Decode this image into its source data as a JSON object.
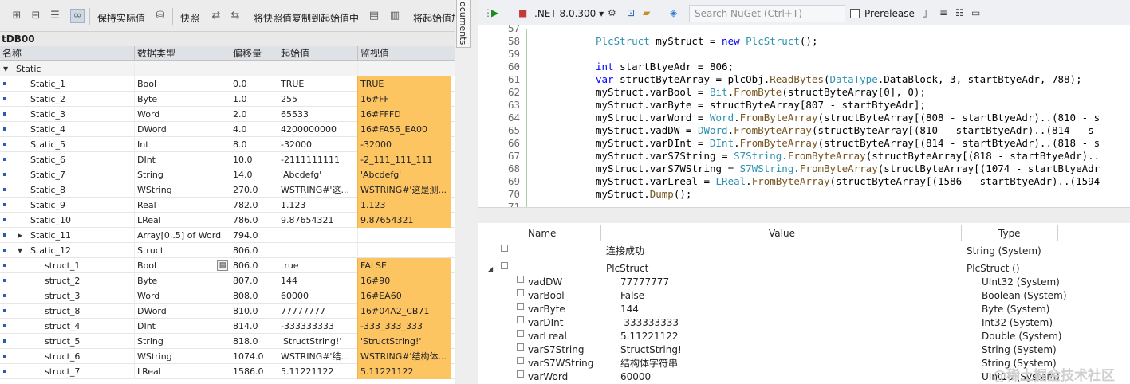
{
  "left": {
    "toolbar": {
      "keep_actual": "保持实际值",
      "snapshot": "快照",
      "copy_snapshot": "将快照值复制到起始值中",
      "start_to": "将起始值加"
    },
    "db_title": "tDB00",
    "headers": [
      "名称",
      "数据类型",
      "偏移量",
      "起始值",
      "监视值"
    ],
    "rows": [
      {
        "name": "Static",
        "type": "",
        "offset": "",
        "start": "",
        "monitor": "",
        "level": 0,
        "expand": "▼",
        "marker": false
      },
      {
        "name": "Static_1",
        "type": "Bool",
        "offset": "0.0",
        "start": "TRUE",
        "monitor": "TRUE",
        "level": 1,
        "marker": true
      },
      {
        "name": "Static_2",
        "type": "Byte",
        "offset": "1.0",
        "start": "255",
        "monitor": "16#FF",
        "level": 1,
        "marker": true
      },
      {
        "name": "Static_3",
        "type": "Word",
        "offset": "2.0",
        "start": "65533",
        "monitor": "16#FFFD",
        "level": 1,
        "marker": true
      },
      {
        "name": "Static_4",
        "type": "DWord",
        "offset": "4.0",
        "start": "4200000000",
        "monitor": "16#FA56_EA00",
        "level": 1,
        "marker": true
      },
      {
        "name": "Static_5",
        "type": "Int",
        "offset": "8.0",
        "start": "-32000",
        "monitor": "-32000",
        "level": 1,
        "marker": true
      },
      {
        "name": "Static_6",
        "type": "DInt",
        "offset": "10.0",
        "start": "-2111111111",
        "monitor": "-2_111_111_111",
        "level": 1,
        "marker": true
      },
      {
        "name": "Static_7",
        "type": "String",
        "offset": "14.0",
        "start": "'Abcdefg'",
        "monitor": "'Abcdefg'",
        "level": 1,
        "marker": true
      },
      {
        "name": "Static_8",
        "type": "WString",
        "offset": "270.0",
        "start": "WSTRING#'这...",
        "monitor": "WSTRING#'这是测...",
        "level": 1,
        "marker": true
      },
      {
        "name": "Static_9",
        "type": "Real",
        "offset": "782.0",
        "start": "1.123",
        "monitor": "1.123",
        "level": 1,
        "marker": true
      },
      {
        "name": "Static_10",
        "type": "LReal",
        "offset": "786.0",
        "start": "9.87654321",
        "monitor": "9.87654321",
        "level": 1,
        "marker": true
      },
      {
        "name": "Static_11",
        "type": "Array[0..5] of Word",
        "offset": "794.0",
        "start": "",
        "monitor": "",
        "level": 1,
        "expand": "▶",
        "marker": true
      },
      {
        "name": "Static_12",
        "type": "Struct",
        "offset": "806.0",
        "start": "",
        "monitor": "",
        "level": 1,
        "expand": "▼",
        "marker": true
      },
      {
        "name": "struct_1",
        "type": "Bool",
        "offset": "806.0",
        "start": "true",
        "monitor": "FALSE",
        "level": 2,
        "marker": true,
        "btn": true
      },
      {
        "name": "struct_2",
        "type": "Byte",
        "offset": "807.0",
        "start": "144",
        "monitor": "16#90",
        "level": 2,
        "marker": true
      },
      {
        "name": "struct_3",
        "type": "Word",
        "offset": "808.0",
        "start": "60000",
        "monitor": "16#EA60",
        "level": 2,
        "marker": true
      },
      {
        "name": "struct_8",
        "type": "DWord",
        "offset": "810.0",
        "start": "77777777",
        "monitor": "16#04A2_CB71",
        "level": 2,
        "marker": true
      },
      {
        "name": "struct_4",
        "type": "DInt",
        "offset": "814.0",
        "start": "-333333333",
        "monitor": "-333_333_333",
        "level": 2,
        "marker": true
      },
      {
        "name": "struct_5",
        "type": "String",
        "offset": "818.0",
        "start": "'StructString!'",
        "monitor": "'StructString!'",
        "level": 2,
        "marker": true
      },
      {
        "name": "struct_6",
        "type": "WString",
        "offset": "1074.0",
        "start": "WSTRING#'结...",
        "monitor": "WSTRING#'结构体...",
        "level": 2,
        "marker": true
      },
      {
        "name": "struct_7",
        "type": "LReal",
        "offset": "1586.0",
        "start": "5.11221122",
        "monitor": "5.11221122",
        "level": 2,
        "marker": true
      }
    ]
  },
  "splitter_tab": "ocuments",
  "right": {
    "toolbar": {
      "framework": ".NET 8.0.300",
      "search_placeholder": "Search NuGet (Ctrl+T)",
      "prerelease": "Prerelease"
    },
    "code_lines": [
      {
        "n": "57",
        "html": ""
      },
      {
        "n": "58",
        "html": "<span class=\"ty\">PlcStruct</span> myStruct = <span class=\"kw\">new</span> <span class=\"ty\">PlcStruct</span>();"
      },
      {
        "n": "59",
        "html": ""
      },
      {
        "n": "60",
        "html": "<span class=\"kw\">int</span> startBtyeAdr = 806;"
      },
      {
        "n": "61",
        "html": "<span class=\"kw\">var</span> structByteArray = plcObj.<span class=\"mt\">ReadBytes</span>(<span class=\"ty\">DataType</span>.DataBlock, 3, startBtyeAdr, 788);"
      },
      {
        "n": "62",
        "html": "myStruct.varBool = <span class=\"ty\">Bit</span>.<span class=\"mt\">FromByte</span>(structByteArray[0], 0);"
      },
      {
        "n": "63",
        "html": "myStruct.varByte = structByteArray[807 - startBtyeAdr];"
      },
      {
        "n": "64",
        "html": "myStruct.varWord = <span class=\"ty\">Word</span>.<span class=\"mt\">FromByteArray</span>(structByteArray[(808 - startBtyeAdr)..(810 - s"
      },
      {
        "n": "65",
        "html": "myStruct.vadDW = <span class=\"ty\">DWord</span>.<span class=\"mt\">FromByteArray</span>(structByteArray[(810 - startBtyeAdr)..(814 - s"
      },
      {
        "n": "66",
        "html": "myStruct.varDInt = <span class=\"ty\">DInt</span>.<span class=\"mt\">FromByteArray</span>(structByteArray[(814 - startBtyeAdr)..(818 - s"
      },
      {
        "n": "67",
        "html": "myStruct.varS7String = <span class=\"ty\">S7String</span>.<span class=\"mt\">FromByteArray</span>(structByteArray[(818 - startBtyeAdr).."
      },
      {
        "n": "68",
        "html": "myStruct.varS7WString = <span class=\"ty\">S7WString</span>.<span class=\"mt\">FromByteArray</span>(structByteArray[(1074 - startBtyeAdr"
      },
      {
        "n": "69",
        "html": "myStruct.varLreal = <span class=\"ty\">LReal</span>.<span class=\"mt\">FromByteArray</span>(structByteArray[(1586 - startBtyeAdr)..(1594"
      },
      {
        "n": "70",
        "html": "myStruct.<span class=\"mt\">Dump</span>();"
      },
      {
        "n": "71",
        "html": ""
      }
    ],
    "results": {
      "headers": {
        "name": "Name",
        "value": "Value",
        "type": "Type"
      },
      "rows": [
        {
          "name": "",
          "value": "连接成功",
          "type": "String (System)",
          "kind": "top"
        },
        {
          "name": "",
          "value": "PlcStruct",
          "type": "PlcStruct ()",
          "kind": "top",
          "expand": true
        },
        {
          "name": "vadDW",
          "value": "77777777",
          "type": "UInt32 (System)",
          "kind": "child"
        },
        {
          "name": "varBool",
          "value": "False",
          "type": "Boolean (System)",
          "kind": "child"
        },
        {
          "name": "varByte",
          "value": "144",
          "type": "Byte (System)",
          "kind": "child"
        },
        {
          "name": "varDInt",
          "value": "-333333333",
          "type": "Int32 (System)",
          "kind": "child"
        },
        {
          "name": "varLreal",
          "value": "5.11221122",
          "type": "Double (System)",
          "kind": "child"
        },
        {
          "name": "varS7String",
          "value": "StructString!",
          "type": "String (System)",
          "kind": "child"
        },
        {
          "name": "varS7WString",
          "value": "结构体字符串",
          "type": "String (System)",
          "kind": "child"
        },
        {
          "name": "varWord",
          "value": "60000",
          "type": "UInt16 (System)",
          "kind": "child"
        }
      ]
    }
  },
  "watermark": "@稀土掘金技术社区"
}
